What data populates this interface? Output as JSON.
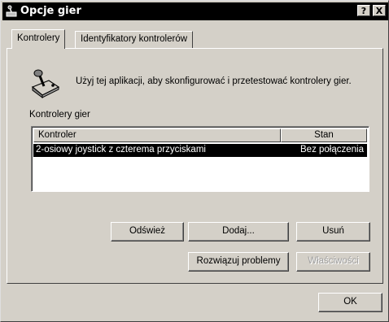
{
  "window": {
    "title": "Opcje gier",
    "help_label": "?",
    "close_label": "X"
  },
  "tabs": [
    {
      "label": "Kontrolery",
      "active": true
    },
    {
      "label": "Identyfikatory kontrolerów",
      "active": false
    }
  ],
  "description": "Użyj tej aplikacji, aby skonfigurować i przetestować kontrolery gier.",
  "group_label": "Kontrolery gier",
  "list": {
    "columns": [
      "Kontroler",
      "Stan"
    ],
    "rows": [
      {
        "name": "2-osiowy joystick z czterema przyciskami",
        "status": "Bez połączenia",
        "selected": true
      }
    ]
  },
  "buttons": {
    "refresh": "Odśwież",
    "add": "Dodaj...",
    "remove": "Usuń",
    "troubleshoot": "Rozwiązuj problemy",
    "properties": "Właściwości",
    "ok": "OK"
  }
}
